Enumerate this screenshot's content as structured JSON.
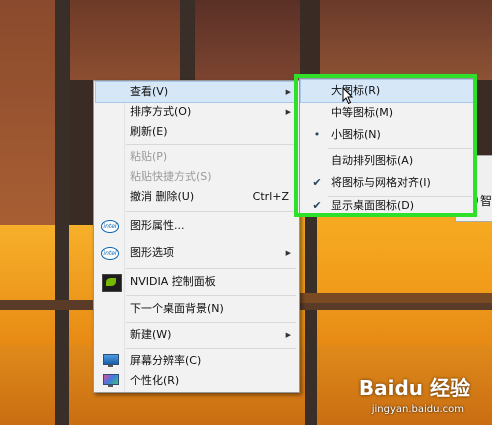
{
  "context_menu": {
    "items": [
      {
        "label": "查看(V)",
        "submenu": true,
        "highlighted": true
      },
      {
        "label": "排序方式(O)",
        "submenu": true
      },
      {
        "label": "刷新(E)"
      },
      {
        "label": "粘贴(P)",
        "disabled": true
      },
      {
        "label": "粘贴快捷方式(S)",
        "disabled": true
      },
      {
        "label": "撤消 删除(U)",
        "shortcut": "Ctrl+Z"
      },
      {
        "label": "图形属性...",
        "icon": "intel-icon"
      },
      {
        "label": "图形选项",
        "icon": "intel-icon",
        "submenu": true
      },
      {
        "label": "NVIDIA 控制面板",
        "icon": "nvidia-icon"
      },
      {
        "label": "下一个桌面背景(N)"
      },
      {
        "label": "新建(W)",
        "submenu": true
      },
      {
        "label": "屏幕分辨率(C)",
        "icon": "display-icon"
      },
      {
        "label": "个性化(R)",
        "icon": "personalize-icon"
      }
    ]
  },
  "view_submenu": {
    "items": [
      {
        "label": "大图标(R)",
        "highlighted": true
      },
      {
        "label": "中等图标(M)"
      },
      {
        "label": "小图标(N)",
        "mark": "•"
      },
      {
        "label": "自动排列图标(A)"
      },
      {
        "label": "将图标与网格对齐(I)",
        "mark": "✔"
      },
      {
        "label": "显示桌面图标(D)",
        "mark": "✔"
      }
    ]
  },
  "icons": {
    "intel": "intel",
    "arrow": "▶"
  },
  "side_window": {
    "text": "智"
  },
  "watermark": {
    "brand": "Baidu 经验",
    "url": "jingyan.baidu.com"
  },
  "colors": {
    "highlight": "#d6e7f8",
    "annotation_box": "#2fe02a",
    "wallpaper_orange": "#f2a21b"
  }
}
